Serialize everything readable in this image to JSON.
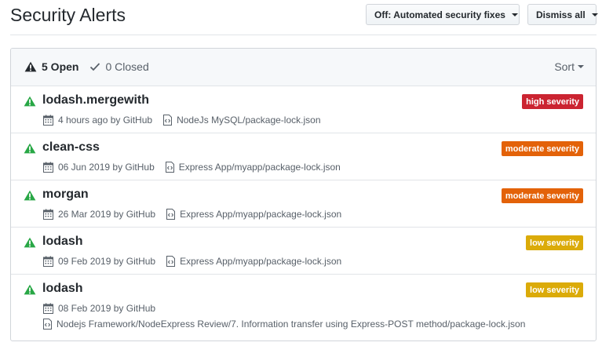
{
  "page": {
    "title": "Security Alerts",
    "automated_fixes_label": "Off: Automated security fixes",
    "dismiss_label": "Dismiss all"
  },
  "filters": {
    "open_label": "5 Open",
    "closed_label": "0 Closed",
    "sort_label": "Sort"
  },
  "colors": {
    "high": "#cb2431",
    "moderate": "#e36209",
    "low": "#dbab09",
    "alert_icon": "#28a745"
  },
  "alerts": [
    {
      "name": "lodash.mergewith",
      "severity": "high severity",
      "severity_level": "high",
      "date": "4 hours ago by GitHub",
      "path": "NodeJs MySQL/package-lock.json"
    },
    {
      "name": "clean-css",
      "severity": "moderate severity",
      "severity_level": "moderate",
      "date": "06 Jun 2019 by GitHub",
      "path": "Express App/myapp/package-lock.json"
    },
    {
      "name": "morgan",
      "severity": "moderate severity",
      "severity_level": "moderate",
      "date": "26 Mar 2019 by GitHub",
      "path": "Express App/myapp/package-lock.json"
    },
    {
      "name": "lodash",
      "severity": "low severity",
      "severity_level": "low",
      "date": "09 Feb 2019 by GitHub",
      "path": "Express App/myapp/package-lock.json"
    },
    {
      "name": "lodash",
      "severity": "low severity",
      "severity_level": "low",
      "date": "08 Feb 2019 by GitHub",
      "path": "Nodejs Framework/NodeExpress Review/7. Information transfer using Express-POST method/package-lock.json"
    }
  ]
}
